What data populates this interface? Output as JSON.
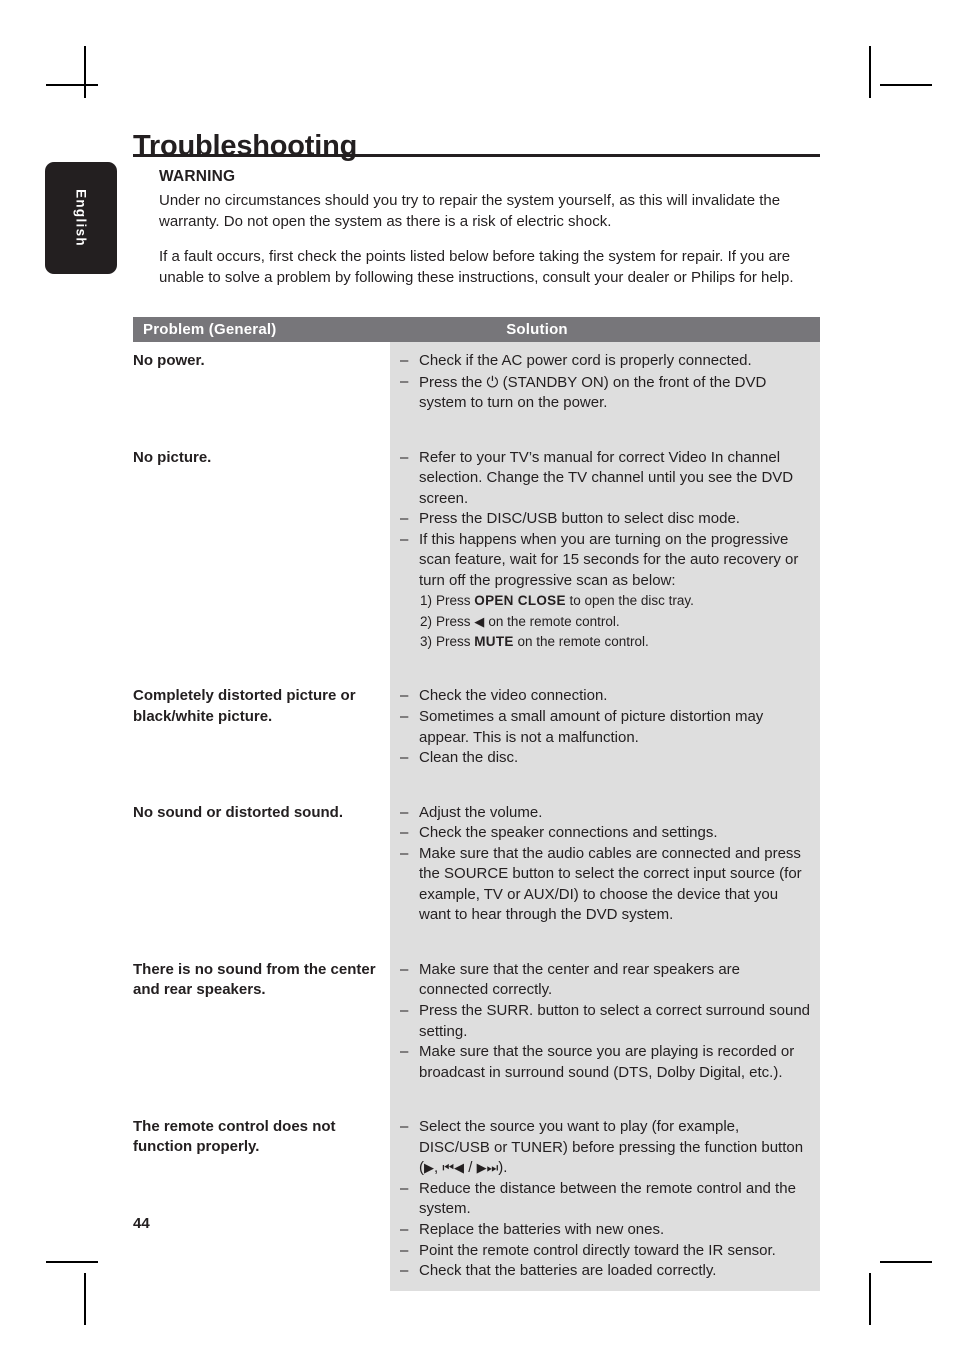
{
  "page": {
    "title": "Troubleshooting",
    "number": "44",
    "language_tab": "English",
    "colors": {
      "text": "#231f20",
      "table_header_bg": "#77767a",
      "solution_cell_bg": "#dedede",
      "tab_bg": "#231f20"
    }
  },
  "intro": {
    "warning_heading": "WARNING",
    "paragraphs": [
      "Under no circumstances should you try to repair the system yourself, as this will invalidate the warranty. Do not open the system as there is a risk of electric shock.",
      "If a fault occurs, first check the points listed below before taking the system for repair. If you are unable to solve a problem by following these instructions, consult your dealer or Philips for help."
    ]
  },
  "table": {
    "headers": {
      "problem": "Problem (General)",
      "solution": "Solution"
    },
    "rows": [
      {
        "problem": "No power.",
        "solutions": [
          "Check if the AC power cord is properly connected.",
          "Press the ⏻ (STANDBY ON) on the front of the DVD system to turn on the power."
        ]
      },
      {
        "problem": "No picture.",
        "solutions": [
          "Refer to your TV’s manual for correct Video In channel selection. Change the TV channel until you see the DVD screen.",
          "Press the DISC/USB button to select disc mode.",
          "If this happens when you are turning on the progressive scan feature, wait for 15 seconds for the auto recovery or turn off the progressive scan as below:"
        ],
        "numbered": [
          {
            "num": "1)",
            "pre": "Press ",
            "bold": "OPEN CLOSE",
            "post": " to open the disc tray."
          },
          {
            "num": "2)",
            "pre": "Press ",
            "bold": "◀",
            "post": " on the remote control."
          },
          {
            "num": "3)",
            "pre": "Press ",
            "bold": "MUTE",
            "post": " on the remote control."
          }
        ]
      },
      {
        "problem": "Completely distorted picture or black/white picture.",
        "solutions": [
          "Check the video connection.",
          "Sometimes a small amount of picture distortion may appear. This is not a malfunction.",
          "Clean the disc."
        ]
      },
      {
        "problem": "No sound or distorted sound.",
        "solutions": [
          "Adjust the volume.",
          "Check the speaker connections and settings.",
          "Make sure that the audio cables are connected and press the SOURCE button to select the correct input source (for example, TV or AUX/DI) to choose the device that you want to hear through the DVD system."
        ]
      },
      {
        "problem": "There is no sound from the center and rear speakers.",
        "solutions": [
          "Make sure that the center and rear speakers are connected correctly.",
          "Press the SURR. button to select a correct surround sound setting.",
          "Make sure that the source you are playing is recorded or broadcast in surround sound (DTS, Dolby Digital, etc.)."
        ]
      },
      {
        "problem": "The remote control does not function properly.",
        "solutions": [
          "Select the source you want to play (for example, DISC/USB or TUNER) before pressing the function button (▶, ⏮◀ / ▶⏭).",
          "Reduce the distance between the remote control and the system.",
          "Replace the batteries with new ones.",
          "Point the remote control directly toward the IR sensor.",
          "Check that the batteries are loaded correctly."
        ]
      }
    ]
  }
}
